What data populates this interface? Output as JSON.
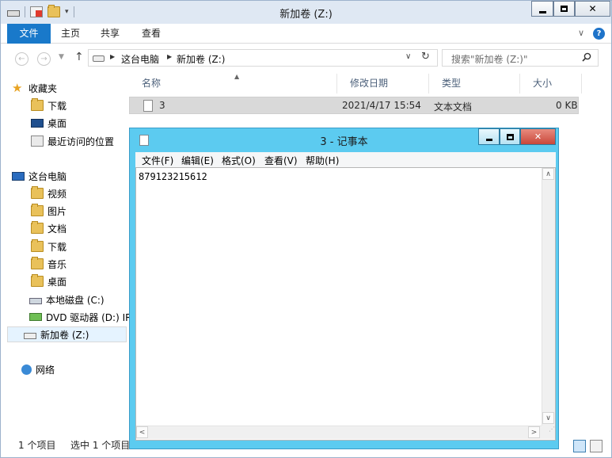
{
  "explorer": {
    "title": "新加卷 (Z:)",
    "ribbon_tabs": [
      "文件",
      "主页",
      "共享",
      "查看"
    ],
    "breadcrumb": [
      "这台电脑",
      "新加卷 (Z:)"
    ],
    "search_placeholder": "搜索\"新加卷 (Z:)\"",
    "sidebar": {
      "favorites_label": "收藏夹",
      "favorites": [
        "下载",
        "桌面",
        "最近访问的位置"
      ],
      "pc_label": "这台电脑",
      "pc_items": [
        "视频",
        "图片",
        "文档",
        "下载",
        "音乐",
        "桌面",
        "本地磁盘 (C:)",
        "DVD 驱动器 (D:) IR",
        "新加卷 (Z:)"
      ],
      "network_label": "网络"
    },
    "columns": [
      "名称",
      "修改日期",
      "类型",
      "大小"
    ],
    "files": [
      {
        "name": "3",
        "modified": "2021/4/17 15:54",
        "type": "文本文档",
        "size": "0 KB"
      }
    ],
    "status": {
      "count": "1 个项目",
      "selected": "选中 1 个项目"
    }
  },
  "notepad": {
    "title": "3 - 记事本",
    "menu": [
      "文件(F)",
      "编辑(E)",
      "格式(O)",
      "查看(V)",
      "帮助(H)"
    ],
    "content": "879123215612"
  }
}
